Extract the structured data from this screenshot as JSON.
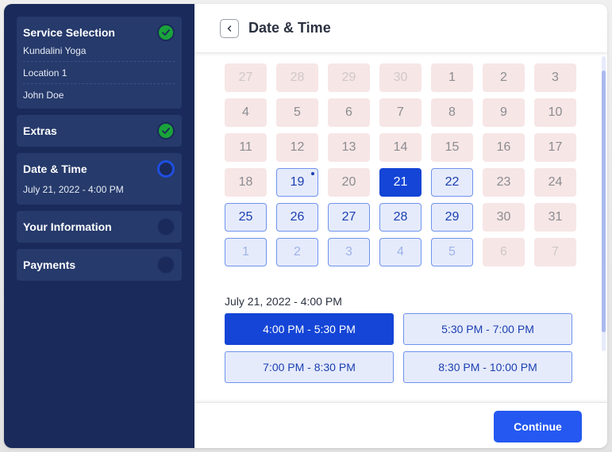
{
  "sidebar": {
    "steps": [
      {
        "title": "Service Selection",
        "status": "completed",
        "details": [
          "Kundalini Yoga",
          "Location 1",
          "John Doe"
        ]
      },
      {
        "title": "Extras",
        "status": "completed"
      },
      {
        "title": "Date & Time",
        "status": "active",
        "details": [
          "July 21, 2022 - 4:00 PM"
        ]
      },
      {
        "title": "Your Information",
        "status": "pending"
      },
      {
        "title": "Payments",
        "status": "pending"
      }
    ]
  },
  "header": {
    "back_icon": "chevron-left-icon",
    "title": "Date & Time"
  },
  "calendar": {
    "weeks": [
      [
        {
          "d": "27",
          "state": "unavailable",
          "outside": true
        },
        {
          "d": "28",
          "state": "unavailable",
          "outside": true
        },
        {
          "d": "29",
          "state": "unavailable",
          "outside": true
        },
        {
          "d": "30",
          "state": "unavailable",
          "outside": true
        },
        {
          "d": "1",
          "state": "unavailable"
        },
        {
          "d": "2",
          "state": "unavailable"
        },
        {
          "d": "3",
          "state": "unavailable"
        }
      ],
      [
        {
          "d": "4",
          "state": "unavailable"
        },
        {
          "d": "5",
          "state": "unavailable"
        },
        {
          "d": "6",
          "state": "unavailable"
        },
        {
          "d": "7",
          "state": "unavailable"
        },
        {
          "d": "8",
          "state": "unavailable"
        },
        {
          "d": "9",
          "state": "unavailable"
        },
        {
          "d": "10",
          "state": "unavailable"
        }
      ],
      [
        {
          "d": "11",
          "state": "unavailable"
        },
        {
          "d": "12",
          "state": "unavailable"
        },
        {
          "d": "13",
          "state": "unavailable"
        },
        {
          "d": "14",
          "state": "unavailable"
        },
        {
          "d": "15",
          "state": "unavailable"
        },
        {
          "d": "16",
          "state": "unavailable"
        },
        {
          "d": "17",
          "state": "unavailable"
        }
      ],
      [
        {
          "d": "18",
          "state": "unavailable"
        },
        {
          "d": "19",
          "state": "available",
          "today": true
        },
        {
          "d": "20",
          "state": "unavailable"
        },
        {
          "d": "21",
          "state": "selected"
        },
        {
          "d": "22",
          "state": "available"
        },
        {
          "d": "23",
          "state": "unavailable"
        },
        {
          "d": "24",
          "state": "unavailable"
        }
      ],
      [
        {
          "d": "25",
          "state": "available"
        },
        {
          "d": "26",
          "state": "available"
        },
        {
          "d": "27",
          "state": "available"
        },
        {
          "d": "28",
          "state": "available"
        },
        {
          "d": "29",
          "state": "available"
        },
        {
          "d": "30",
          "state": "unavailable"
        },
        {
          "d": "31",
          "state": "unavailable"
        }
      ],
      [
        {
          "d": "1",
          "state": "available",
          "outside": true
        },
        {
          "d": "2",
          "state": "available",
          "outside": true
        },
        {
          "d": "3",
          "state": "available",
          "outside": true
        },
        {
          "d": "4",
          "state": "available",
          "outside": true
        },
        {
          "d": "5",
          "state": "available",
          "outside": true
        },
        {
          "d": "6",
          "state": "unavailable",
          "outside": true
        },
        {
          "d": "7",
          "state": "unavailable",
          "outside": true
        }
      ]
    ]
  },
  "selection": {
    "label": "July 21, 2022 - 4:00 PM"
  },
  "time_slots": [
    {
      "label": "4:00 PM - 5:30 PM",
      "selected": true
    },
    {
      "label": "5:30 PM - 7:00 PM",
      "selected": false
    },
    {
      "label": "7:00 PM - 8:30 PM",
      "selected": false
    },
    {
      "label": "8:30 PM - 10:00 PM",
      "selected": false
    }
  ],
  "footer": {
    "continue_label": "Continue"
  },
  "colors": {
    "sidebar_bg": "#1a2a5a",
    "accent": "#1445d6",
    "success": "#1aa33a",
    "button": "#2458f0"
  }
}
